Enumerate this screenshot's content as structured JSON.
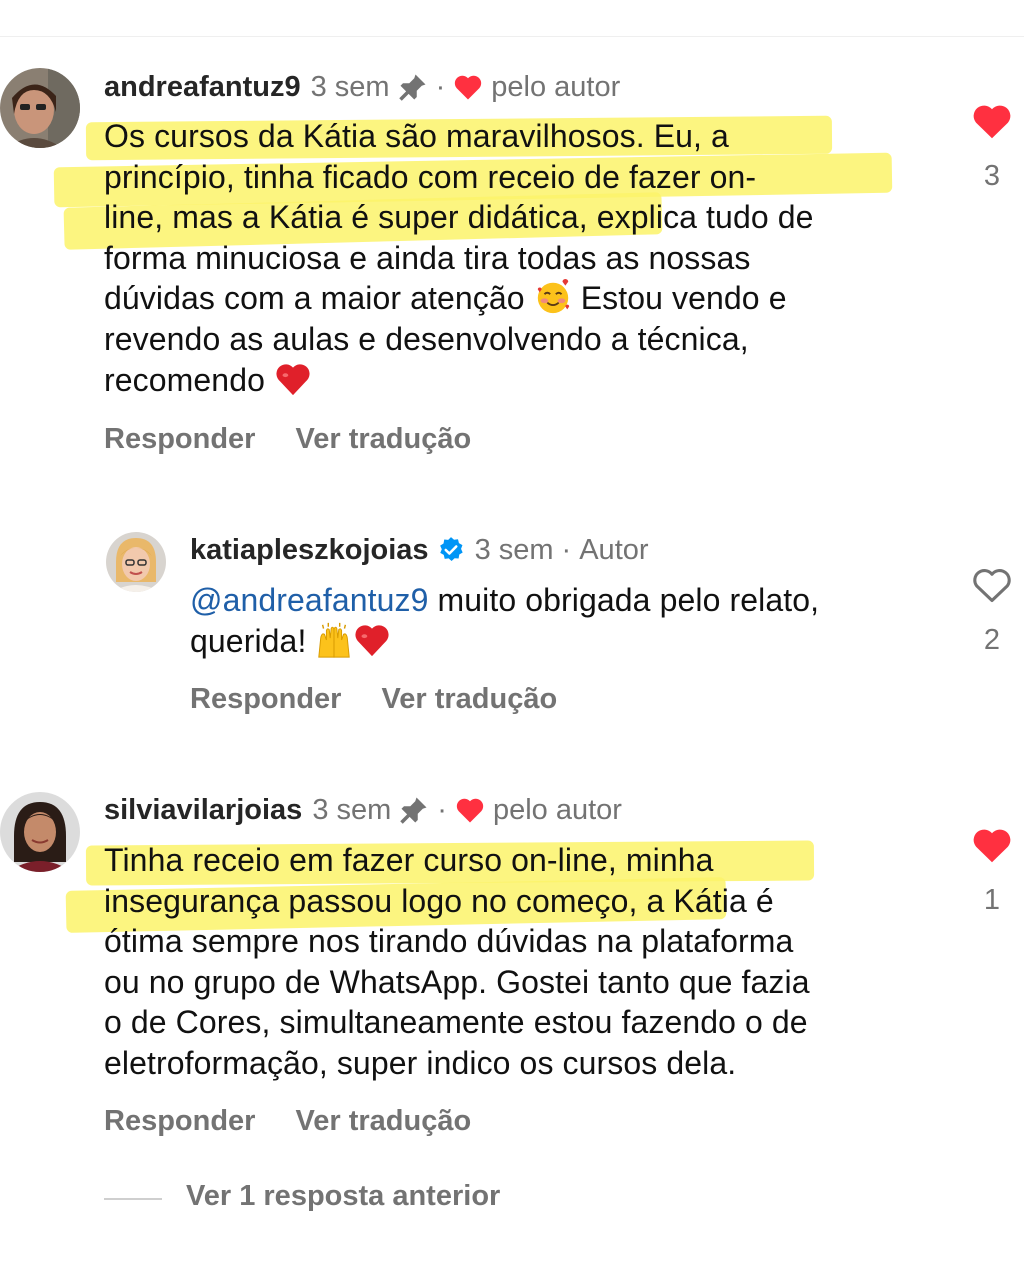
{
  "comments": [
    {
      "username": "andreafantuz9",
      "time": "3 sem",
      "dot": "·",
      "liked_by": "pelo autor",
      "lines": [
        "Os cursos da Kátia são maravilhosos. Eu, a",
        "princípio, tinha ficado com receio de fazer on-",
        "line, mas a Kátia é super didática, explica tudo de",
        "forma minuciosa e ainda tira todas as nossas",
        "dúvidas com a maior atenção",
        " Estou vendo e",
        "revendo as aulas e desenvolvendo a técnica,",
        "recomendo"
      ],
      "reply_label": "Responder",
      "translate_label": "Ver tradução",
      "like_count": "3",
      "liked": true
    },
    {
      "username": "katiapleszkojoias",
      "time": "3 sem",
      "dot": "·",
      "author_tag": "Autor",
      "mention": "@andreafantuz9",
      "lines": [
        " muito obrigada pelo relato,",
        "querida!"
      ],
      "reply_label": "Responder",
      "translate_label": "Ver tradução",
      "like_count": "2",
      "liked": false
    },
    {
      "username": "silviavilarjoias",
      "time": "3 sem",
      "dot": "·",
      "liked_by": "pelo autor",
      "lines": [
        "Tinha receio em fazer curso on-line,  minha",
        "insegurança passou logo no começo,  a Kátia é",
        "ótima  sempre nos tirando dúvidas na plataforma",
        "ou no grupo de WhatsApp. Gostei tanto que fazia",
        "o de Cores, simultaneamente estou fazendo o de",
        "eletroformação, super indico os cursos dela."
      ],
      "reply_label": "Responder",
      "translate_label": "Ver tradução",
      "like_count": "1",
      "liked": true
    }
  ],
  "view_more": "Ver 1 resposta anterior",
  "colors": {
    "like_red": "#ff3040",
    "highlight": "#fbf36a",
    "mention": "#1f5fa8",
    "verified": "#0095f6"
  },
  "icons": [
    "pin-icon",
    "heart-icon",
    "verified-badge-icon",
    "smiling-face-with-hearts-emoji",
    "raising-hands-emoji",
    "red-heart-emoji"
  ]
}
